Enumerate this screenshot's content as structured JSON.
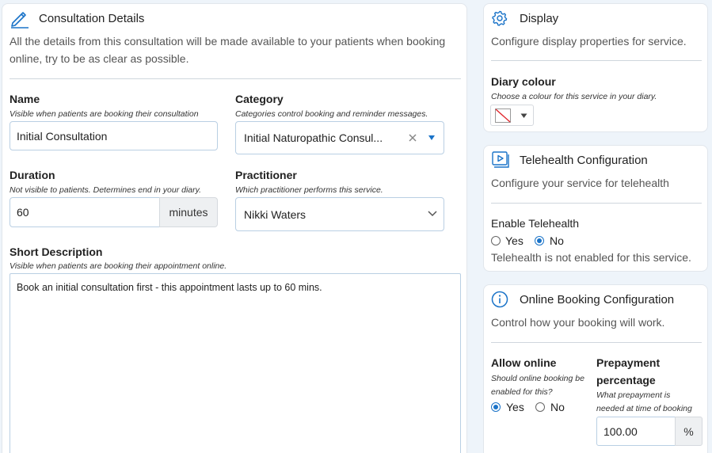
{
  "consultation": {
    "title": "Consultation Details",
    "description": "All the details from this consultation will be made available to your patients when booking online, try to be as clear as possible.",
    "name": {
      "label": "Name",
      "hint": "Visible when patients are booking their consultation",
      "value": "Initial Consultation"
    },
    "category": {
      "label": "Category",
      "hint": "Categories control booking and reminder messages.",
      "value": "Initial Naturopathic Consul..."
    },
    "duration": {
      "label": "Duration",
      "hint": "Not visible to patients. Determines end in your diary.",
      "value": "60",
      "unit": "minutes"
    },
    "practitioner": {
      "label": "Practitioner",
      "hint": "Which practitioner performs this service.",
      "value": "Nikki Waters"
    },
    "short_description": {
      "label": "Short Description",
      "hint": "Visible when patients are booking their appointment online.",
      "value": "Book an initial consultation first - this appointment lasts up to 60 mins."
    }
  },
  "display": {
    "title": "Display",
    "description": "Configure display properties for service.",
    "diary_colour": {
      "label": "Diary colour",
      "hint": "Choose a colour for this service in your diary."
    }
  },
  "telehealth": {
    "title": "Telehealth Configuration",
    "description": "Configure your service for telehealth",
    "enable_label": "Enable Telehealth",
    "yes_label": "Yes",
    "no_label": "No",
    "selected": "No",
    "status": "Telehealth is not enabled for this service."
  },
  "online_booking": {
    "title": "Online Booking Configuration",
    "description": "Control how your booking will work.",
    "allow_online": {
      "label": "Allow online",
      "hint_line1": "Should online booking be",
      "hint_line2": "enabled for this?",
      "yes_label": "Yes",
      "no_label": "No",
      "selected": "Yes"
    },
    "prepayment": {
      "label_line1": "Prepayment",
      "label_line2": "percentage",
      "hint_line1": "What prepayment is",
      "hint_line2": "needed at time of booking",
      "value": "100.00",
      "unit": "%"
    }
  },
  "colors": {
    "accent": "#1a73c8",
    "background": "#eef4fa",
    "input_border": "#b9cfe3"
  }
}
